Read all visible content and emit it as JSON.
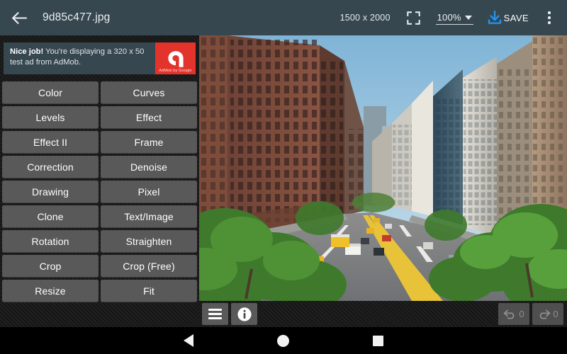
{
  "toolbar": {
    "back_icon": "back-arrow-icon",
    "file_name": "9d85c477.jpg",
    "dimensions": "1500 x 2000",
    "fullscreen_icon": "fullscreen-icon",
    "zoom_level": "100%",
    "zoom_caret_icon": "chevron-down-icon",
    "save_icon": "download-icon",
    "save_label": "SAVE",
    "overflow_icon": "overflow-menu-icon",
    "accent_color": "#2196f3",
    "background_color": "#37474f"
  },
  "ad": {
    "headline": "Nice job!",
    "body": " You're displaying a 320 x 50 test ad from AdMob.",
    "logo_icon": "admob-logo-icon",
    "attribution": "AdMob by Google",
    "logo_color": "#e2342c"
  },
  "tools": [
    {
      "label": "Color"
    },
    {
      "label": "Curves"
    },
    {
      "label": "Levels"
    },
    {
      "label": "Effect"
    },
    {
      "label": "Effect II"
    },
    {
      "label": "Frame"
    },
    {
      "label": "Correction"
    },
    {
      "label": "Denoise"
    },
    {
      "label": "Drawing"
    },
    {
      "label": "Pixel"
    },
    {
      "label": "Clone"
    },
    {
      "label": "Text/Image"
    },
    {
      "label": "Rotation"
    },
    {
      "label": "Straighten"
    },
    {
      "label": "Crop"
    },
    {
      "label": "Crop (Free)"
    },
    {
      "label": "Resize"
    },
    {
      "label": "Fit"
    }
  ],
  "canvas": {
    "description": "City avenue photo: tall brick and glass buildings lining a busy street with yellow taxis, buses and green trees under a blue sky",
    "sky_color": "#9ec9e2"
  },
  "bottom_bar": {
    "menu_icon": "hamburger-menu-icon",
    "info_icon": "info-icon",
    "undo_icon": "undo-icon",
    "undo_count": "0",
    "redo_icon": "redo-icon",
    "redo_count": "0"
  },
  "nav_bar": {
    "back_icon": "android-back-icon",
    "home_icon": "android-home-icon",
    "recents_icon": "android-recents-icon"
  }
}
